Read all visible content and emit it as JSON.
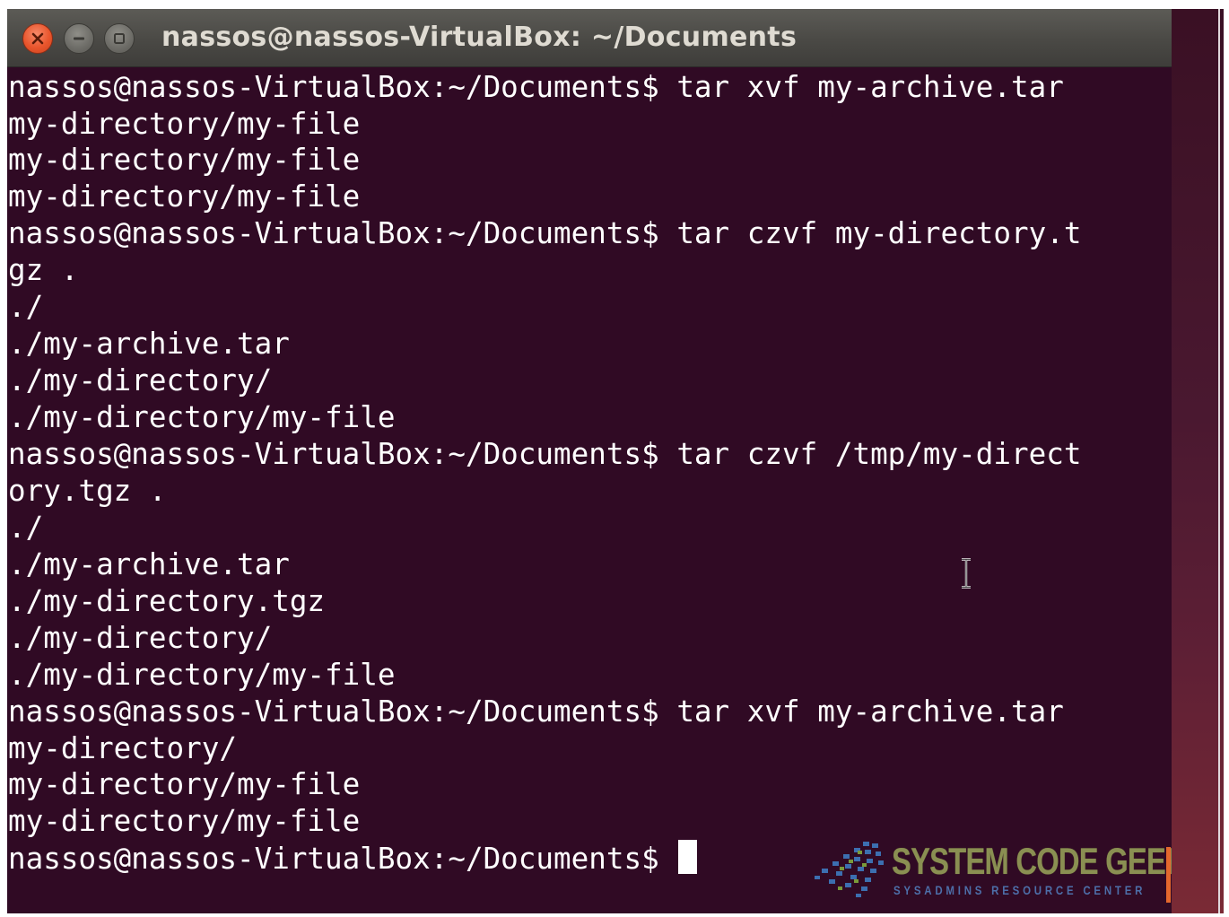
{
  "window": {
    "title": "nassos@nassos-VirtualBox: ~/Documents",
    "buttons": {
      "close_icon": "close-icon",
      "minimize_icon": "minimize-icon",
      "maximize_icon": "maximize-icon"
    }
  },
  "terminal": {
    "lines": [
      "nassos@nassos-VirtualBox:~/Documents$ tar xvf my-archive.tar",
      "my-directory/my-file",
      "my-directory/my-file",
      "my-directory/my-file",
      "nassos@nassos-VirtualBox:~/Documents$ tar czvf my-directory.t",
      "gz .",
      "./",
      "./my-archive.tar",
      "./my-directory/",
      "./my-directory/my-file",
      "nassos@nassos-VirtualBox:~/Documents$ tar czvf /tmp/my-direct",
      "ory.tgz .",
      "./",
      "./my-archive.tar",
      "./my-directory.tgz",
      "./my-directory/",
      "./my-directory/my-file",
      "nassos@nassos-VirtualBox:~/Documents$ tar xvf my-archive.tar",
      "my-directory/",
      "my-directory/my-file",
      "my-directory/my-file"
    ],
    "prompt": "nassos@nassos-VirtualBox:~/Documents$ ",
    "cursor_icon": "text-cursor-icon"
  },
  "watermark": {
    "name": "SYSTEM CODE GEEKS",
    "tagline": "SYSADMINS RESOURCE CENTER"
  },
  "colors": {
    "terminal_bg": "#300a24",
    "terminal_fg": "#ffffff",
    "close_button": "#e9552c",
    "watermark_accent": "#e4682d"
  }
}
